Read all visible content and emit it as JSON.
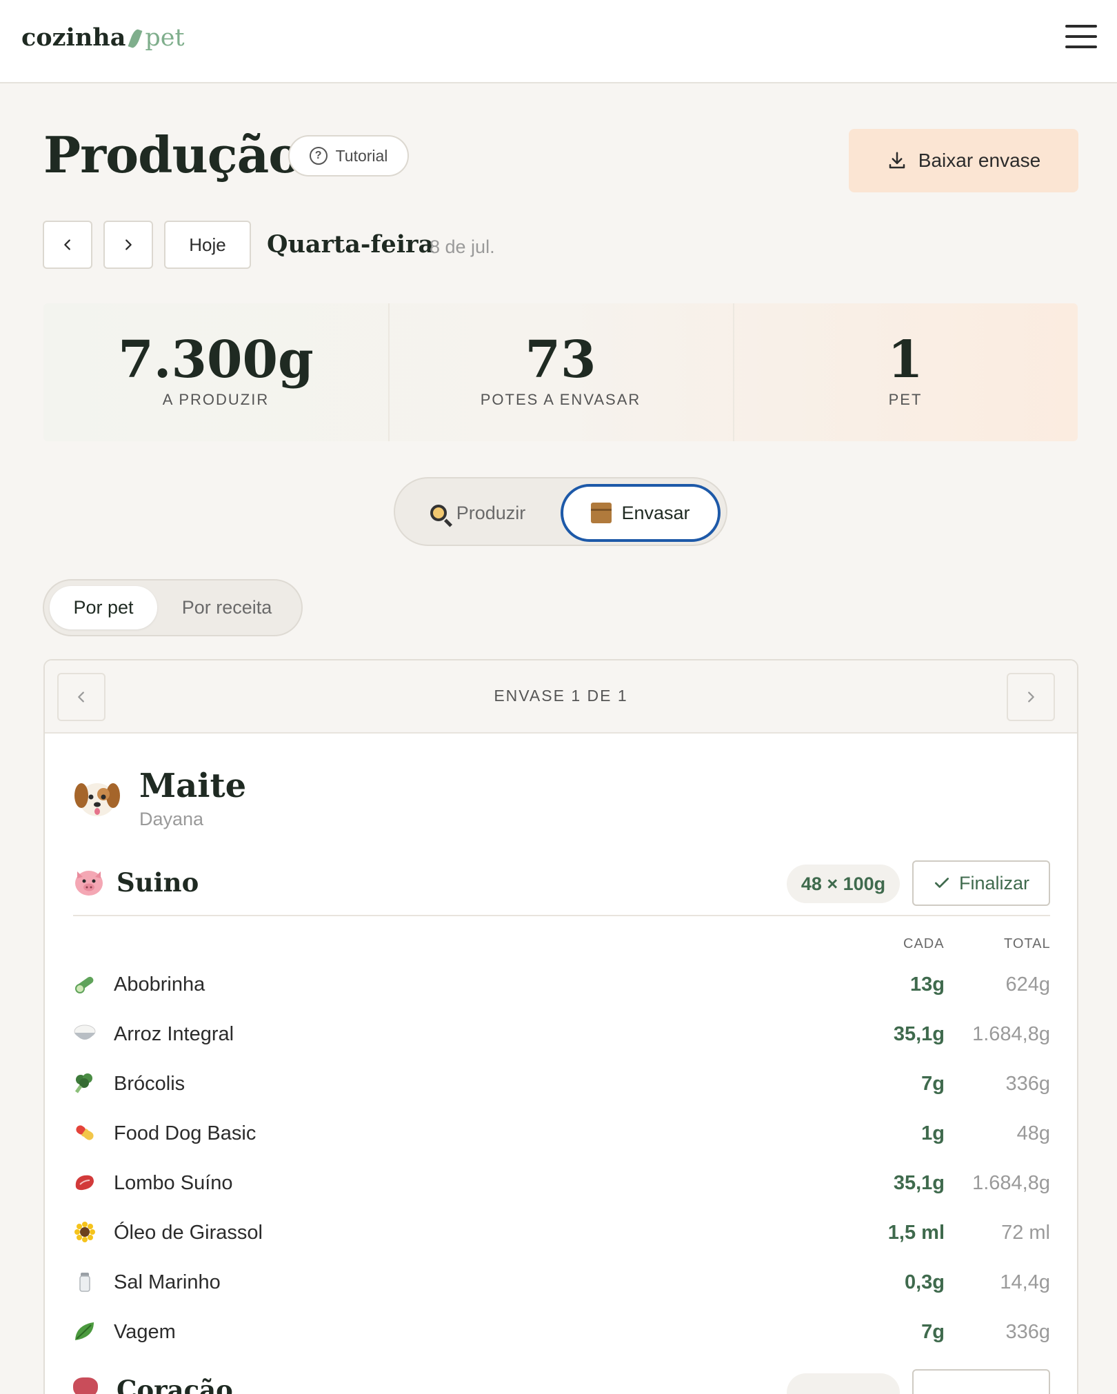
{
  "header": {
    "logo_part1": "cozinha",
    "logo_part2": "pet",
    "menu_icon": "hamburger-menu-icon"
  },
  "page": {
    "title": "Produção",
    "tutorial_label": "Tutorial",
    "download_label": "Baixar envase"
  },
  "date_nav": {
    "prev_icon": "chevron-left-icon",
    "next_icon": "chevron-right-icon",
    "today_label": "Hoje",
    "day_name": "Quarta-feira",
    "day_date": "8 de jul."
  },
  "stats": [
    {
      "value": "7.300g",
      "label": "A PRODUZIR"
    },
    {
      "value": "73",
      "label": "POTES A ENVASAR"
    },
    {
      "value": "1",
      "label": "PET"
    }
  ],
  "mode_toggle": {
    "produzir_label": "Produzir",
    "envasar_label": "Envasar",
    "selected": "Envasar"
  },
  "view_toggle": {
    "por_pet_label": "Por pet",
    "por_receita_label": "Por receita",
    "selected": "Por pet"
  },
  "card": {
    "title": "ENVASE 1 DE 1",
    "pet": {
      "name": "Maite",
      "owner": "Dayana",
      "icon": "dog-face-icon"
    },
    "recipe": {
      "name": "Suino",
      "icon": "pig-face-icon",
      "portion": "48 × 100g",
      "finalize_label": "Finalizar"
    },
    "columns": {
      "each": "CADA",
      "total": "TOTAL"
    },
    "ingredients": [
      {
        "name": "Abobrinha",
        "each": "13g",
        "total": "624g",
        "icon": "cucumber-icon"
      },
      {
        "name": "Arroz Integral",
        "each": "35,1g",
        "total": "1.684,8g",
        "icon": "rice-bowl-icon"
      },
      {
        "name": "Brócolis",
        "each": "7g",
        "total": "336g",
        "icon": "broccoli-icon"
      },
      {
        "name": "Food Dog Basic",
        "each": "1g",
        "total": "48g",
        "icon": "pill-icon"
      },
      {
        "name": "Lombo Suíno",
        "each": "35,1g",
        "total": "1.684,8g",
        "icon": "meat-icon"
      },
      {
        "name": "Óleo de Girassol",
        "each": "1,5 ml",
        "total": "72 ml",
        "icon": "sunflower-icon"
      },
      {
        "name": "Sal Marinho",
        "each": "0,3g",
        "total": "14,4g",
        "icon": "salt-shaker-icon"
      },
      {
        "name": "Vagem",
        "each": "7g",
        "total": "336g",
        "icon": "leafy-green-icon"
      }
    ],
    "next_recipe_name": "Coração"
  },
  "colors": {
    "accent_green": "#3f6a4d",
    "logo_green": "#7fae8c",
    "download_bg": "#fbe5d3",
    "selected_border": "#1d59a8"
  }
}
